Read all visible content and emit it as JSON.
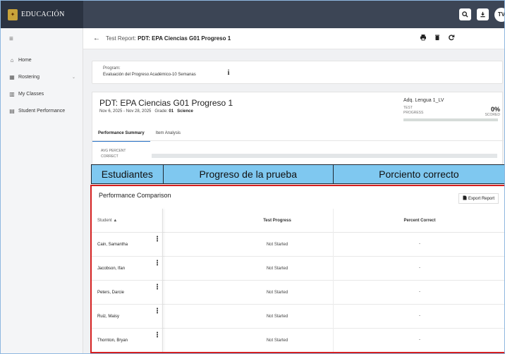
{
  "brand": {
    "logo_text": "EDUCACIÓN"
  },
  "topbar": {
    "avatar_initials": "TV"
  },
  "sidebar": {
    "menu_glyph": "≡",
    "items": [
      {
        "label": "Home",
        "icon": "home-icon",
        "glyph": "⌂"
      },
      {
        "label": "Rostering",
        "icon": "roster-icon",
        "glyph": "▦",
        "expandable": true
      },
      {
        "label": "My Classes",
        "icon": "classes-icon",
        "glyph": "▥"
      },
      {
        "label": "Student Performance",
        "icon": "performance-icon",
        "glyph": "▤"
      }
    ]
  },
  "header": {
    "prefix": "Test Report:",
    "title": "PDT: EPA Ciencias G01 Progreso 1"
  },
  "program": {
    "label": "Program:",
    "value": "Evaluación del Progreso Académico-10 Semanas"
  },
  "test": {
    "title": "PDT: EPA Ciencias G01 Progreso 1",
    "dates": "Nov 6, 2025 - Nov 28, 2025",
    "grade_label": "Grade:",
    "grade_value": "01",
    "subject": "Science",
    "adq": {
      "name": "Adq. Lengua 1_LV",
      "test_label": "TEST",
      "progress_label": "PROGRESS",
      "percent": "0%",
      "scored_label": "SCORED",
      "progress_fraction": 0
    }
  },
  "tabs": [
    {
      "label": "Performance Summary",
      "active": true
    },
    {
      "label": "Item Analysis",
      "active": false
    }
  ],
  "avg": {
    "line1": "AVG PERCENT",
    "line2": "CORRECT"
  },
  "banner": {
    "cells": [
      "Estudiantes",
      "Progreso de la prueba",
      "Porciento correcto"
    ],
    "color": "#7fc8f0"
  },
  "comparison": {
    "title": "Performance Comparison",
    "export_label": "Export Report",
    "columns": {
      "student": "Student",
      "progress": "Test Progress",
      "percent": "Percent Correct"
    },
    "rows": [
      {
        "name": "Cain, Samantha",
        "progress": "Not Started",
        "percent": "-"
      },
      {
        "name": "Jacobson, Ifan",
        "progress": "Not Started",
        "percent": "-"
      },
      {
        "name": "Peters, Darcie",
        "progress": "Not Started",
        "percent": "-"
      },
      {
        "name": "Ruiz, Maisy",
        "progress": "Not Started",
        "percent": "-"
      },
      {
        "name": "Thornton, Bryan",
        "progress": "Not Started",
        "percent": "-"
      }
    ],
    "highlight_color": "#d42020"
  }
}
